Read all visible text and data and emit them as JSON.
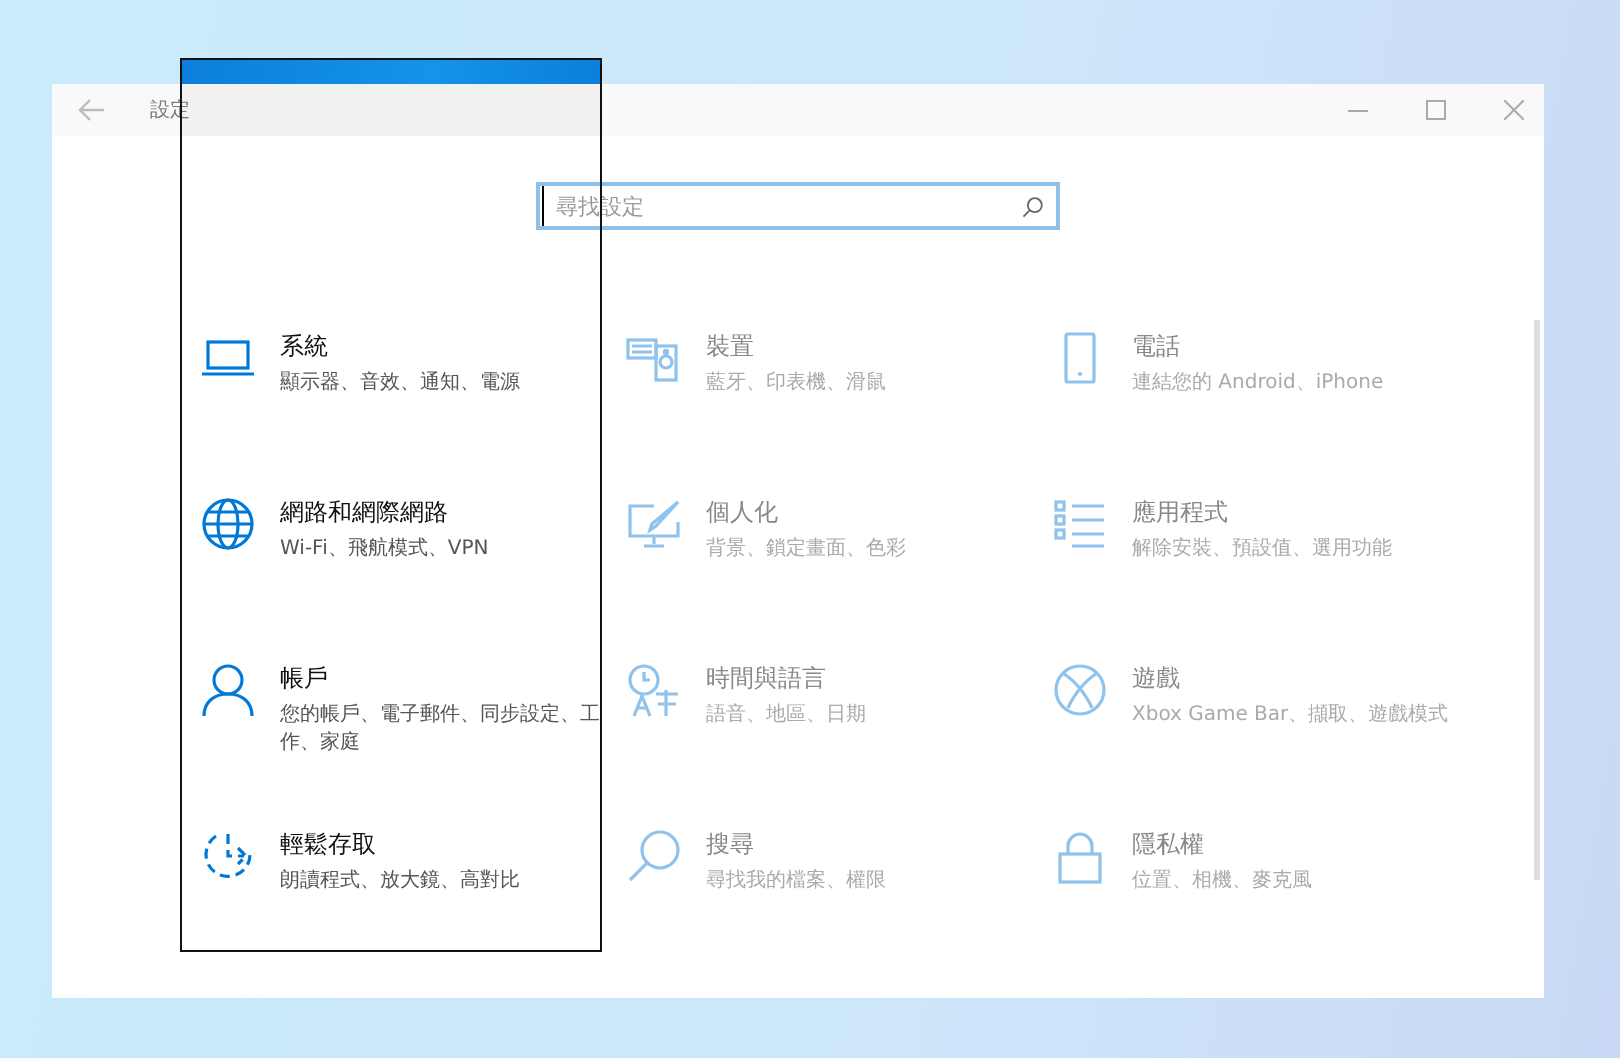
{
  "window": {
    "title": "設定"
  },
  "search": {
    "placeholder": "尋找設定"
  },
  "categories": [
    {
      "title": "系統",
      "subtitle": "顯示器、音效、通知、電源"
    },
    {
      "title": "裝置",
      "subtitle": "藍牙、印表機、滑鼠"
    },
    {
      "title": "電話",
      "subtitle": "連結您的 Android、iPhone"
    },
    {
      "title": "網路和網際網路",
      "subtitle": "Wi-Fi、飛航模式、VPN"
    },
    {
      "title": "個人化",
      "subtitle": "背景、鎖定畫面、色彩"
    },
    {
      "title": "應用程式",
      "subtitle": "解除安裝、預設值、選用功能"
    },
    {
      "title": "帳戶",
      "subtitle": "您的帳戶、電子郵件、同步設定、工作、家庭"
    },
    {
      "title": "時間與語言",
      "subtitle": "語音、地區、日期"
    },
    {
      "title": "遊戲",
      "subtitle": "Xbox Game Bar、擷取、遊戲模式"
    },
    {
      "title": "輕鬆存取",
      "subtitle": "朗讀程式、放大鏡、高對比"
    },
    {
      "title": "搜尋",
      "subtitle": "尋找我的檔案、權限"
    },
    {
      "title": "隱私權",
      "subtitle": "位置、相機、麥克風"
    }
  ]
}
